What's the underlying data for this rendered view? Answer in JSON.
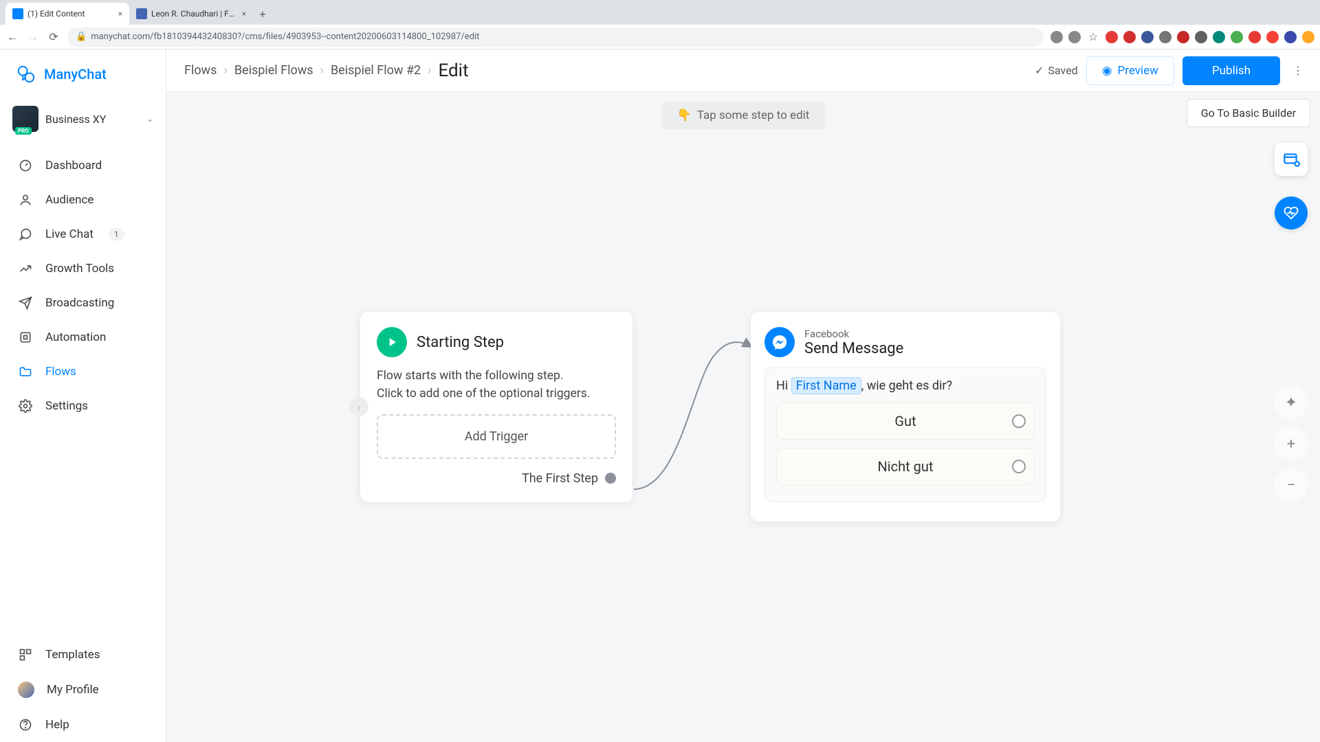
{
  "browser": {
    "tabs": [
      {
        "title": "(1) Edit Content",
        "active": true
      },
      {
        "title": "Leon R. Chaudhari | Facebook",
        "active": false
      }
    ],
    "url": "manychat.com/fb181039443240830?/cms/files/4903953--content20200603114800_102987/edit"
  },
  "brand": "ManyChat",
  "business": {
    "name": "Business XY"
  },
  "nav": {
    "dashboard": "Dashboard",
    "audience": "Audience",
    "livechat": "Live Chat",
    "livechat_badge": "1",
    "growth": "Growth Tools",
    "broadcasting": "Broadcasting",
    "automation": "Automation",
    "flows": "Flows",
    "settings": "Settings",
    "templates": "Templates",
    "profile": "My Profile",
    "help": "Help"
  },
  "breadcrumb": {
    "a": "Flows",
    "b": "Beispiel Flows",
    "c": "Beispiel Flow #2",
    "current": "Edit"
  },
  "topbar": {
    "saved": "Saved",
    "preview": "Preview",
    "publish": "Publish",
    "go_basic": "Go To Basic Builder"
  },
  "hint": "Tap some step to edit",
  "start_node": {
    "title": "Starting Step",
    "desc_l1": "Flow starts with the following step.",
    "desc_l2": "Click to add one of the optional triggers.",
    "add_trigger": "Add Trigger",
    "first_step": "The First Step"
  },
  "send_node": {
    "platform": "Facebook",
    "title": "Send Message",
    "msg_prefix": "Hi ",
    "msg_var": "First Name",
    "msg_suffix": ", wie geht es dir?",
    "reply1": "Gut",
    "reply2": "Nicht gut"
  }
}
